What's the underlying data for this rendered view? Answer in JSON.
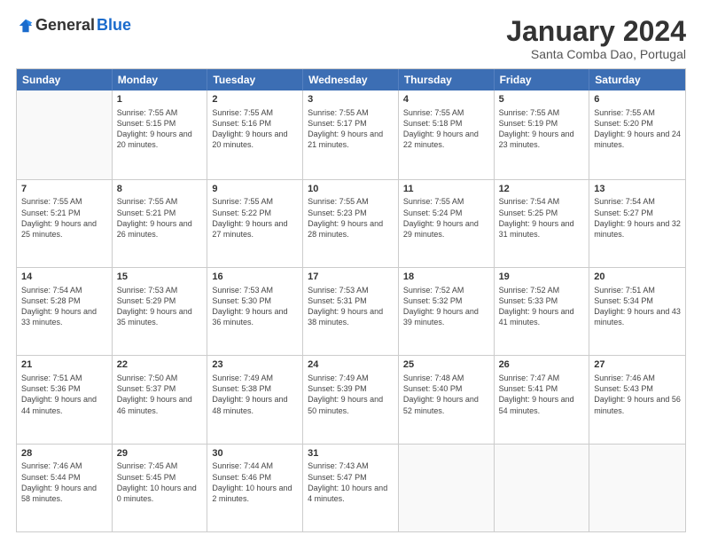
{
  "header": {
    "logo_general": "General",
    "logo_blue": "Blue",
    "month_title": "January 2024",
    "location": "Santa Comba Dao, Portugal"
  },
  "days_of_week": [
    "Sunday",
    "Monday",
    "Tuesday",
    "Wednesday",
    "Thursday",
    "Friday",
    "Saturday"
  ],
  "weeks": [
    [
      {
        "day": "",
        "sunrise": "",
        "sunset": "",
        "daylight": ""
      },
      {
        "day": "1",
        "sunrise": "Sunrise: 7:55 AM",
        "sunset": "Sunset: 5:15 PM",
        "daylight": "Daylight: 9 hours and 20 minutes."
      },
      {
        "day": "2",
        "sunrise": "Sunrise: 7:55 AM",
        "sunset": "Sunset: 5:16 PM",
        "daylight": "Daylight: 9 hours and 20 minutes."
      },
      {
        "day": "3",
        "sunrise": "Sunrise: 7:55 AM",
        "sunset": "Sunset: 5:17 PM",
        "daylight": "Daylight: 9 hours and 21 minutes."
      },
      {
        "day": "4",
        "sunrise": "Sunrise: 7:55 AM",
        "sunset": "Sunset: 5:18 PM",
        "daylight": "Daylight: 9 hours and 22 minutes."
      },
      {
        "day": "5",
        "sunrise": "Sunrise: 7:55 AM",
        "sunset": "Sunset: 5:19 PM",
        "daylight": "Daylight: 9 hours and 23 minutes."
      },
      {
        "day": "6",
        "sunrise": "Sunrise: 7:55 AM",
        "sunset": "Sunset: 5:20 PM",
        "daylight": "Daylight: 9 hours and 24 minutes."
      }
    ],
    [
      {
        "day": "7",
        "sunrise": "Sunrise: 7:55 AM",
        "sunset": "Sunset: 5:21 PM",
        "daylight": "Daylight: 9 hours and 25 minutes."
      },
      {
        "day": "8",
        "sunrise": "Sunrise: 7:55 AM",
        "sunset": "Sunset: 5:21 PM",
        "daylight": "Daylight: 9 hours and 26 minutes."
      },
      {
        "day": "9",
        "sunrise": "Sunrise: 7:55 AM",
        "sunset": "Sunset: 5:22 PM",
        "daylight": "Daylight: 9 hours and 27 minutes."
      },
      {
        "day": "10",
        "sunrise": "Sunrise: 7:55 AM",
        "sunset": "Sunset: 5:23 PM",
        "daylight": "Daylight: 9 hours and 28 minutes."
      },
      {
        "day": "11",
        "sunrise": "Sunrise: 7:55 AM",
        "sunset": "Sunset: 5:24 PM",
        "daylight": "Daylight: 9 hours and 29 minutes."
      },
      {
        "day": "12",
        "sunrise": "Sunrise: 7:54 AM",
        "sunset": "Sunset: 5:25 PM",
        "daylight": "Daylight: 9 hours and 31 minutes."
      },
      {
        "day": "13",
        "sunrise": "Sunrise: 7:54 AM",
        "sunset": "Sunset: 5:27 PM",
        "daylight": "Daylight: 9 hours and 32 minutes."
      }
    ],
    [
      {
        "day": "14",
        "sunrise": "Sunrise: 7:54 AM",
        "sunset": "Sunset: 5:28 PM",
        "daylight": "Daylight: 9 hours and 33 minutes."
      },
      {
        "day": "15",
        "sunrise": "Sunrise: 7:53 AM",
        "sunset": "Sunset: 5:29 PM",
        "daylight": "Daylight: 9 hours and 35 minutes."
      },
      {
        "day": "16",
        "sunrise": "Sunrise: 7:53 AM",
        "sunset": "Sunset: 5:30 PM",
        "daylight": "Daylight: 9 hours and 36 minutes."
      },
      {
        "day": "17",
        "sunrise": "Sunrise: 7:53 AM",
        "sunset": "Sunset: 5:31 PM",
        "daylight": "Daylight: 9 hours and 38 minutes."
      },
      {
        "day": "18",
        "sunrise": "Sunrise: 7:52 AM",
        "sunset": "Sunset: 5:32 PM",
        "daylight": "Daylight: 9 hours and 39 minutes."
      },
      {
        "day": "19",
        "sunrise": "Sunrise: 7:52 AM",
        "sunset": "Sunset: 5:33 PM",
        "daylight": "Daylight: 9 hours and 41 minutes."
      },
      {
        "day": "20",
        "sunrise": "Sunrise: 7:51 AM",
        "sunset": "Sunset: 5:34 PM",
        "daylight": "Daylight: 9 hours and 43 minutes."
      }
    ],
    [
      {
        "day": "21",
        "sunrise": "Sunrise: 7:51 AM",
        "sunset": "Sunset: 5:36 PM",
        "daylight": "Daylight: 9 hours and 44 minutes."
      },
      {
        "day": "22",
        "sunrise": "Sunrise: 7:50 AM",
        "sunset": "Sunset: 5:37 PM",
        "daylight": "Daylight: 9 hours and 46 minutes."
      },
      {
        "day": "23",
        "sunrise": "Sunrise: 7:49 AM",
        "sunset": "Sunset: 5:38 PM",
        "daylight": "Daylight: 9 hours and 48 minutes."
      },
      {
        "day": "24",
        "sunrise": "Sunrise: 7:49 AM",
        "sunset": "Sunset: 5:39 PM",
        "daylight": "Daylight: 9 hours and 50 minutes."
      },
      {
        "day": "25",
        "sunrise": "Sunrise: 7:48 AM",
        "sunset": "Sunset: 5:40 PM",
        "daylight": "Daylight: 9 hours and 52 minutes."
      },
      {
        "day": "26",
        "sunrise": "Sunrise: 7:47 AM",
        "sunset": "Sunset: 5:41 PM",
        "daylight": "Daylight: 9 hours and 54 minutes."
      },
      {
        "day": "27",
        "sunrise": "Sunrise: 7:46 AM",
        "sunset": "Sunset: 5:43 PM",
        "daylight": "Daylight: 9 hours and 56 minutes."
      }
    ],
    [
      {
        "day": "28",
        "sunrise": "Sunrise: 7:46 AM",
        "sunset": "Sunset: 5:44 PM",
        "daylight": "Daylight: 9 hours and 58 minutes."
      },
      {
        "day": "29",
        "sunrise": "Sunrise: 7:45 AM",
        "sunset": "Sunset: 5:45 PM",
        "daylight": "Daylight: 10 hours and 0 minutes."
      },
      {
        "day": "30",
        "sunrise": "Sunrise: 7:44 AM",
        "sunset": "Sunset: 5:46 PM",
        "daylight": "Daylight: 10 hours and 2 minutes."
      },
      {
        "day": "31",
        "sunrise": "Sunrise: 7:43 AM",
        "sunset": "Sunset: 5:47 PM",
        "daylight": "Daylight: 10 hours and 4 minutes."
      },
      {
        "day": "",
        "sunrise": "",
        "sunset": "",
        "daylight": ""
      },
      {
        "day": "",
        "sunrise": "",
        "sunset": "",
        "daylight": ""
      },
      {
        "day": "",
        "sunrise": "",
        "sunset": "",
        "daylight": ""
      }
    ]
  ]
}
